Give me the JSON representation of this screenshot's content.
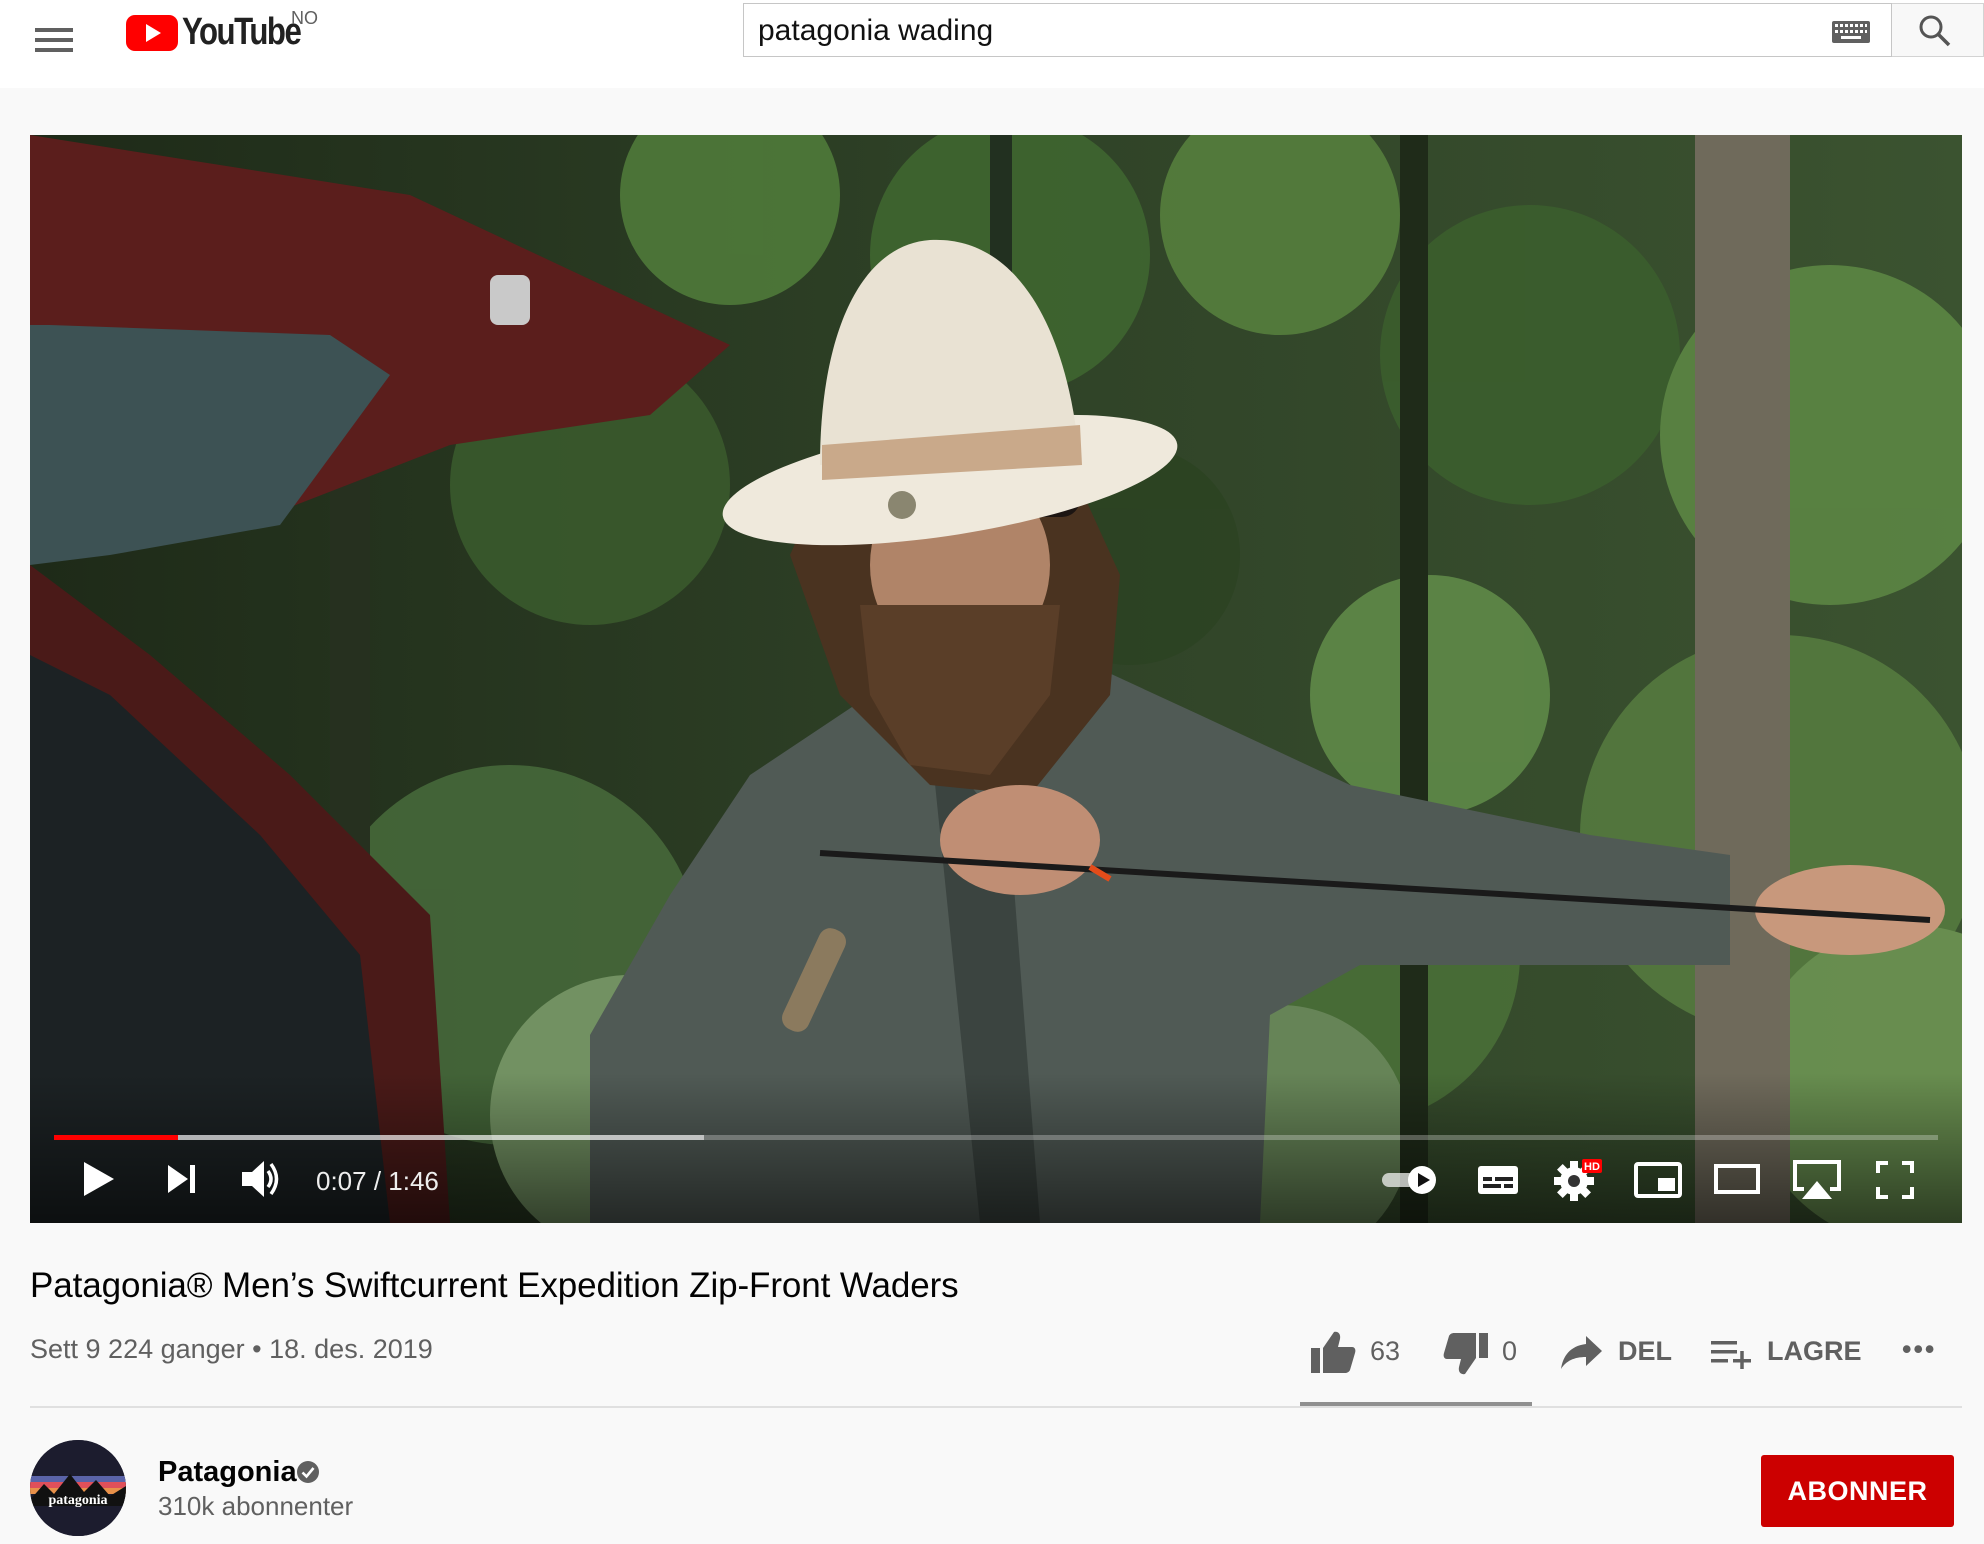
{
  "masthead": {
    "logo_text": "YouTube",
    "country_code": "NO",
    "search_query": "patagonia wading"
  },
  "player": {
    "time_display": "0:07 / 1:46",
    "progress_played_fraction": 0.066,
    "progress_buffered_fraction": 0.345,
    "autoplay": "on",
    "settings_badge": "HD"
  },
  "video": {
    "title": "Patagonia® Men’s Swiftcurrent Expedition Zip-Front Waders",
    "meta": "Sett 9 224 ganger • 18. des. 2019"
  },
  "actions": {
    "likes": "63",
    "dislikes": "0",
    "share_label": "DEL",
    "save_label": "LAGRE",
    "more_label": "•••"
  },
  "channel": {
    "name": "Patagonia",
    "subscribers": "310k abonnenter",
    "avatar_text": "patagonia",
    "subscribe_label": "ABONNER"
  },
  "colors": {
    "brand_red": "#ff0000",
    "subscribe_red": "#cc0000",
    "text_secondary": "#606060"
  },
  "icons": [
    "menu-icon",
    "youtube-play-icon",
    "keyboard-icon",
    "search-icon",
    "play-icon",
    "next-icon",
    "volume-icon",
    "autoplay-toggle-icon",
    "subtitles-icon",
    "settings-icon",
    "miniplayer-icon",
    "theater-icon",
    "airplay-icon",
    "fullscreen-icon",
    "thumbs-up-icon",
    "thumbs-down-icon",
    "share-icon",
    "playlist-add-icon",
    "more-icon",
    "verified-icon"
  ]
}
